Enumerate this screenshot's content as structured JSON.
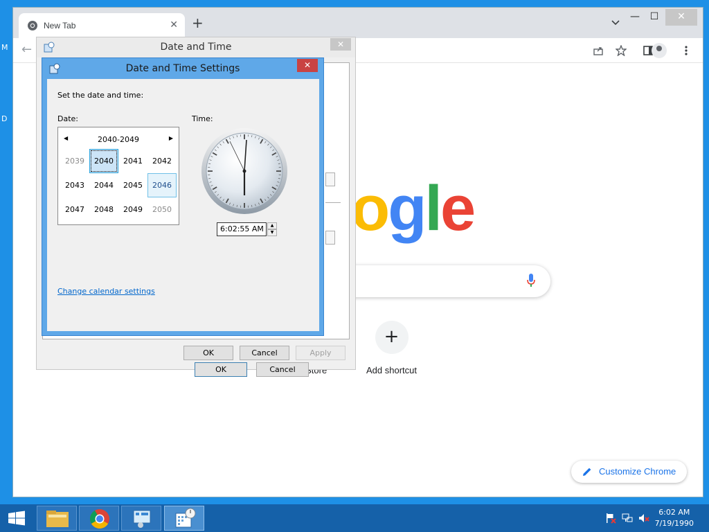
{
  "desktop": {
    "glyph_top": "M",
    "glyph_bottom": "D"
  },
  "chrome": {
    "tab_title": "New Tab",
    "tab_close": "✕",
    "new_tab": "+",
    "window_min": "—",
    "window_max": "☐",
    "window_close": "✕",
    "back": "←",
    "logo_partial": [
      "o",
      "g",
      "l",
      "e"
    ],
    "logo_colors": [
      "#fbbc05",
      "#4285f4",
      "#34a853",
      "#ea4335"
    ],
    "shortcut_web_store": "Web Store",
    "shortcut_add_label": "Add shortcut",
    "shortcut_add_icon": "+",
    "customize_label": "Customize Chrome"
  },
  "date_time_dialog": {
    "title": "Date and Time",
    "close": "✕",
    "ok": "OK",
    "cancel": "Cancel",
    "apply": "Apply"
  },
  "settings_dialog": {
    "title": "Date and Time Settings",
    "close": "✕",
    "instruction": "Set the date and time:",
    "date_label": "Date:",
    "time_label": "Time:",
    "calendar": {
      "header": "2040-2049",
      "prev": "◀",
      "next": "▶",
      "rows": [
        [
          "2039",
          "2040",
          "2041",
          "2042"
        ],
        [
          "2043",
          "2044",
          "2045",
          "2046"
        ],
        [
          "2047",
          "2048",
          "2049",
          "2050"
        ]
      ],
      "selected": "2040",
      "hovered": "2046",
      "muted": [
        "2039",
        "2050"
      ]
    },
    "time_value": "6:02:55 AM",
    "spin_up": "▲",
    "spin_down": "▼",
    "change_calendar_link": "Change calendar settings",
    "ok": "OK",
    "cancel": "Cancel"
  },
  "taskbar": {
    "time": "6:02 AM",
    "date": "7/19/1990"
  }
}
